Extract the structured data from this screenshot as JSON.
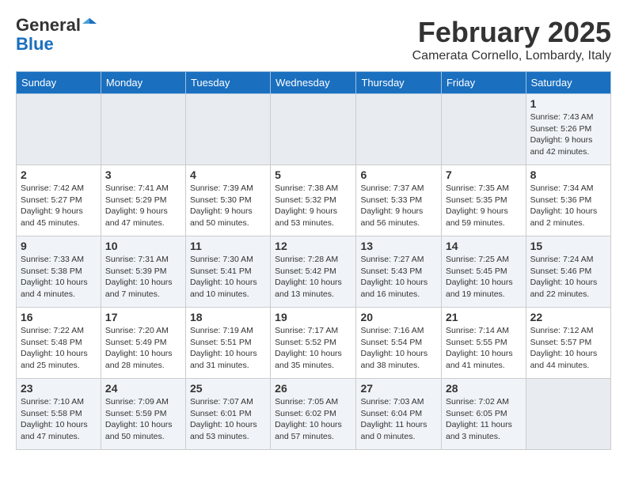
{
  "header": {
    "logo_line1": "General",
    "logo_line2": "Blue",
    "main_title": "February 2025",
    "subtitle": "Camerata Cornello, Lombardy, Italy"
  },
  "days_of_week": [
    "Sunday",
    "Monday",
    "Tuesday",
    "Wednesday",
    "Thursday",
    "Friday",
    "Saturday"
  ],
  "weeks": [
    [
      {
        "day": "",
        "info": ""
      },
      {
        "day": "",
        "info": ""
      },
      {
        "day": "",
        "info": ""
      },
      {
        "day": "",
        "info": ""
      },
      {
        "day": "",
        "info": ""
      },
      {
        "day": "",
        "info": ""
      },
      {
        "day": "1",
        "info": "Sunrise: 7:43 AM\nSunset: 5:26 PM\nDaylight: 9 hours and 42 minutes."
      }
    ],
    [
      {
        "day": "2",
        "info": "Sunrise: 7:42 AM\nSunset: 5:27 PM\nDaylight: 9 hours and 45 minutes."
      },
      {
        "day": "3",
        "info": "Sunrise: 7:41 AM\nSunset: 5:29 PM\nDaylight: 9 hours and 47 minutes."
      },
      {
        "day": "4",
        "info": "Sunrise: 7:39 AM\nSunset: 5:30 PM\nDaylight: 9 hours and 50 minutes."
      },
      {
        "day": "5",
        "info": "Sunrise: 7:38 AM\nSunset: 5:32 PM\nDaylight: 9 hours and 53 minutes."
      },
      {
        "day": "6",
        "info": "Sunrise: 7:37 AM\nSunset: 5:33 PM\nDaylight: 9 hours and 56 minutes."
      },
      {
        "day": "7",
        "info": "Sunrise: 7:35 AM\nSunset: 5:35 PM\nDaylight: 9 hours and 59 minutes."
      },
      {
        "day": "8",
        "info": "Sunrise: 7:34 AM\nSunset: 5:36 PM\nDaylight: 10 hours and 2 minutes."
      }
    ],
    [
      {
        "day": "9",
        "info": "Sunrise: 7:33 AM\nSunset: 5:38 PM\nDaylight: 10 hours and 4 minutes."
      },
      {
        "day": "10",
        "info": "Sunrise: 7:31 AM\nSunset: 5:39 PM\nDaylight: 10 hours and 7 minutes."
      },
      {
        "day": "11",
        "info": "Sunrise: 7:30 AM\nSunset: 5:41 PM\nDaylight: 10 hours and 10 minutes."
      },
      {
        "day": "12",
        "info": "Sunrise: 7:28 AM\nSunset: 5:42 PM\nDaylight: 10 hours and 13 minutes."
      },
      {
        "day": "13",
        "info": "Sunrise: 7:27 AM\nSunset: 5:43 PM\nDaylight: 10 hours and 16 minutes."
      },
      {
        "day": "14",
        "info": "Sunrise: 7:25 AM\nSunset: 5:45 PM\nDaylight: 10 hours and 19 minutes."
      },
      {
        "day": "15",
        "info": "Sunrise: 7:24 AM\nSunset: 5:46 PM\nDaylight: 10 hours and 22 minutes."
      }
    ],
    [
      {
        "day": "16",
        "info": "Sunrise: 7:22 AM\nSunset: 5:48 PM\nDaylight: 10 hours and 25 minutes."
      },
      {
        "day": "17",
        "info": "Sunrise: 7:20 AM\nSunset: 5:49 PM\nDaylight: 10 hours and 28 minutes."
      },
      {
        "day": "18",
        "info": "Sunrise: 7:19 AM\nSunset: 5:51 PM\nDaylight: 10 hours and 31 minutes."
      },
      {
        "day": "19",
        "info": "Sunrise: 7:17 AM\nSunset: 5:52 PM\nDaylight: 10 hours and 35 minutes."
      },
      {
        "day": "20",
        "info": "Sunrise: 7:16 AM\nSunset: 5:54 PM\nDaylight: 10 hours and 38 minutes."
      },
      {
        "day": "21",
        "info": "Sunrise: 7:14 AM\nSunset: 5:55 PM\nDaylight: 10 hours and 41 minutes."
      },
      {
        "day": "22",
        "info": "Sunrise: 7:12 AM\nSunset: 5:57 PM\nDaylight: 10 hours and 44 minutes."
      }
    ],
    [
      {
        "day": "23",
        "info": "Sunrise: 7:10 AM\nSunset: 5:58 PM\nDaylight: 10 hours and 47 minutes."
      },
      {
        "day": "24",
        "info": "Sunrise: 7:09 AM\nSunset: 5:59 PM\nDaylight: 10 hours and 50 minutes."
      },
      {
        "day": "25",
        "info": "Sunrise: 7:07 AM\nSunset: 6:01 PM\nDaylight: 10 hours and 53 minutes."
      },
      {
        "day": "26",
        "info": "Sunrise: 7:05 AM\nSunset: 6:02 PM\nDaylight: 10 hours and 57 minutes."
      },
      {
        "day": "27",
        "info": "Sunrise: 7:03 AM\nSunset: 6:04 PM\nDaylight: 11 hours and 0 minutes."
      },
      {
        "day": "28",
        "info": "Sunrise: 7:02 AM\nSunset: 6:05 PM\nDaylight: 11 hours and 3 minutes."
      },
      {
        "day": "",
        "info": ""
      }
    ]
  ]
}
